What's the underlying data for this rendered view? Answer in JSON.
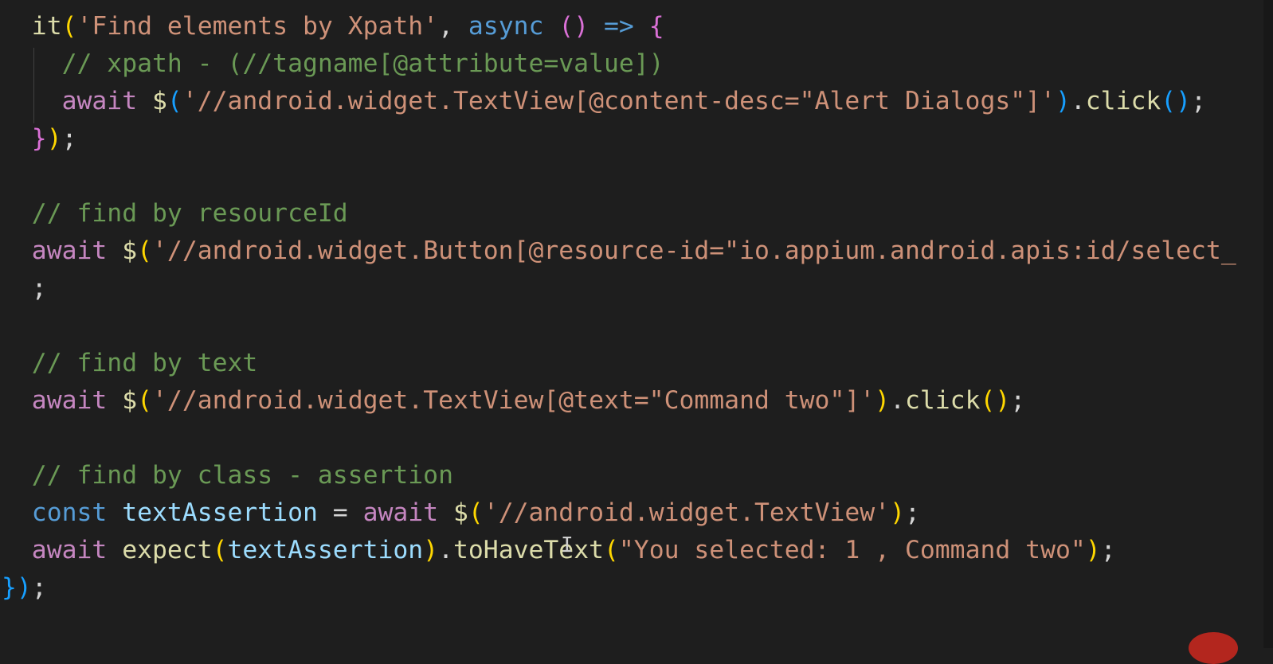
{
  "lines": [
    {
      "indent": 2,
      "tokens": [
        {
          "t": "it",
          "k": "fn"
        },
        {
          "t": "(",
          "k": "br1"
        },
        {
          "t": "'Find elements by Xpath'",
          "k": "str"
        },
        {
          "t": ", ",
          "k": "pl"
        },
        {
          "t": "async",
          "k": "st"
        },
        {
          "t": " ",
          "k": "pl"
        },
        {
          "t": "()",
          "k": "br2"
        },
        {
          "t": " => ",
          "k": "st"
        },
        {
          "t": "{",
          "k": "br2"
        }
      ]
    },
    {
      "indent": 4,
      "tokens": [
        {
          "t": "// xpath - (//tagname[@attribute=value])",
          "k": "cm"
        }
      ]
    },
    {
      "indent": 4,
      "tokens": [
        {
          "t": "await",
          "k": "kw"
        },
        {
          "t": " $",
          "k": "fn"
        },
        {
          "t": "(",
          "k": "br3"
        },
        {
          "t": "'//android.widget.TextView[@content-desc=\"Alert Dialogs\"]'",
          "k": "str"
        },
        {
          "t": ")",
          "k": "br3"
        },
        {
          "t": ".",
          "k": "pl"
        },
        {
          "t": "click",
          "k": "fn"
        },
        {
          "t": "()",
          "k": "br3"
        },
        {
          "t": ";",
          "k": "pl"
        }
      ]
    },
    {
      "indent": 2,
      "tokens": [
        {
          "t": "}",
          "k": "br2"
        },
        {
          "t": ")",
          "k": "br1"
        },
        {
          "t": ";",
          "k": "pl"
        }
      ]
    },
    {
      "indent": 2,
      "tokens": []
    },
    {
      "indent": 2,
      "tokens": [
        {
          "t": "// find by resourceId",
          "k": "cm"
        }
      ]
    },
    {
      "indent": 2,
      "tokens": [
        {
          "t": "await",
          "k": "kw"
        },
        {
          "t": " $",
          "k": "fn"
        },
        {
          "t": "(",
          "k": "br1"
        },
        {
          "t": "'//android.widget.Button[@resource-id=\"io.appium.android.apis:id/select_",
          "k": "str"
        }
      ]
    },
    {
      "indent": 2,
      "tokens": [
        {
          "t": ";",
          "k": "pl"
        }
      ]
    },
    {
      "indent": 2,
      "tokens": []
    },
    {
      "indent": 2,
      "tokens": [
        {
          "t": "// find by text",
          "k": "cm"
        }
      ]
    },
    {
      "indent": 2,
      "tokens": [
        {
          "t": "await",
          "k": "kw"
        },
        {
          "t": " $",
          "k": "fn"
        },
        {
          "t": "(",
          "k": "br1"
        },
        {
          "t": "'//android.widget.TextView[@text=\"Command two\"]'",
          "k": "str"
        },
        {
          "t": ")",
          "k": "br1"
        },
        {
          "t": ".",
          "k": "pl"
        },
        {
          "t": "click",
          "k": "fn"
        },
        {
          "t": "()",
          "k": "br1"
        },
        {
          "t": ";",
          "k": "pl"
        }
      ]
    },
    {
      "indent": 2,
      "tokens": []
    },
    {
      "indent": 2,
      "tokens": [
        {
          "t": "// find by class - assertion",
          "k": "cm"
        }
      ]
    },
    {
      "indent": 2,
      "tokens": [
        {
          "t": "const",
          "k": "st"
        },
        {
          "t": " textAssertion",
          "k": "var"
        },
        {
          "t": " = ",
          "k": "pl"
        },
        {
          "t": "await",
          "k": "kw"
        },
        {
          "t": " $",
          "k": "fn"
        },
        {
          "t": "(",
          "k": "br1"
        },
        {
          "t": "'//android.widget.TextView'",
          "k": "str"
        },
        {
          "t": ")",
          "k": "br1"
        },
        {
          "t": ";",
          "k": "pl"
        }
      ]
    },
    {
      "indent": 2,
      "tokens": [
        {
          "t": "await",
          "k": "kw"
        },
        {
          "t": " expect",
          "k": "fn"
        },
        {
          "t": "(",
          "k": "br1"
        },
        {
          "t": "textAssertion",
          "k": "var"
        },
        {
          "t": ")",
          "k": "br1"
        },
        {
          "t": ".",
          "k": "pl"
        },
        {
          "t": "toHaveText",
          "k": "fn"
        },
        {
          "t": "(",
          "k": "br1"
        },
        {
          "t": "\"You selected: 1 , Command two\"",
          "k": "str"
        },
        {
          "t": ")",
          "k": "br1"
        },
        {
          "t": ";",
          "k": "pl"
        }
      ]
    },
    {
      "indent": 0,
      "tokens": [
        {
          "t": "}",
          "k": "br3"
        },
        {
          "t": ")",
          "k": "br3"
        },
        {
          "t": ";",
          "k": "pl"
        }
      ]
    }
  ],
  "cursor_glyph": "I"
}
